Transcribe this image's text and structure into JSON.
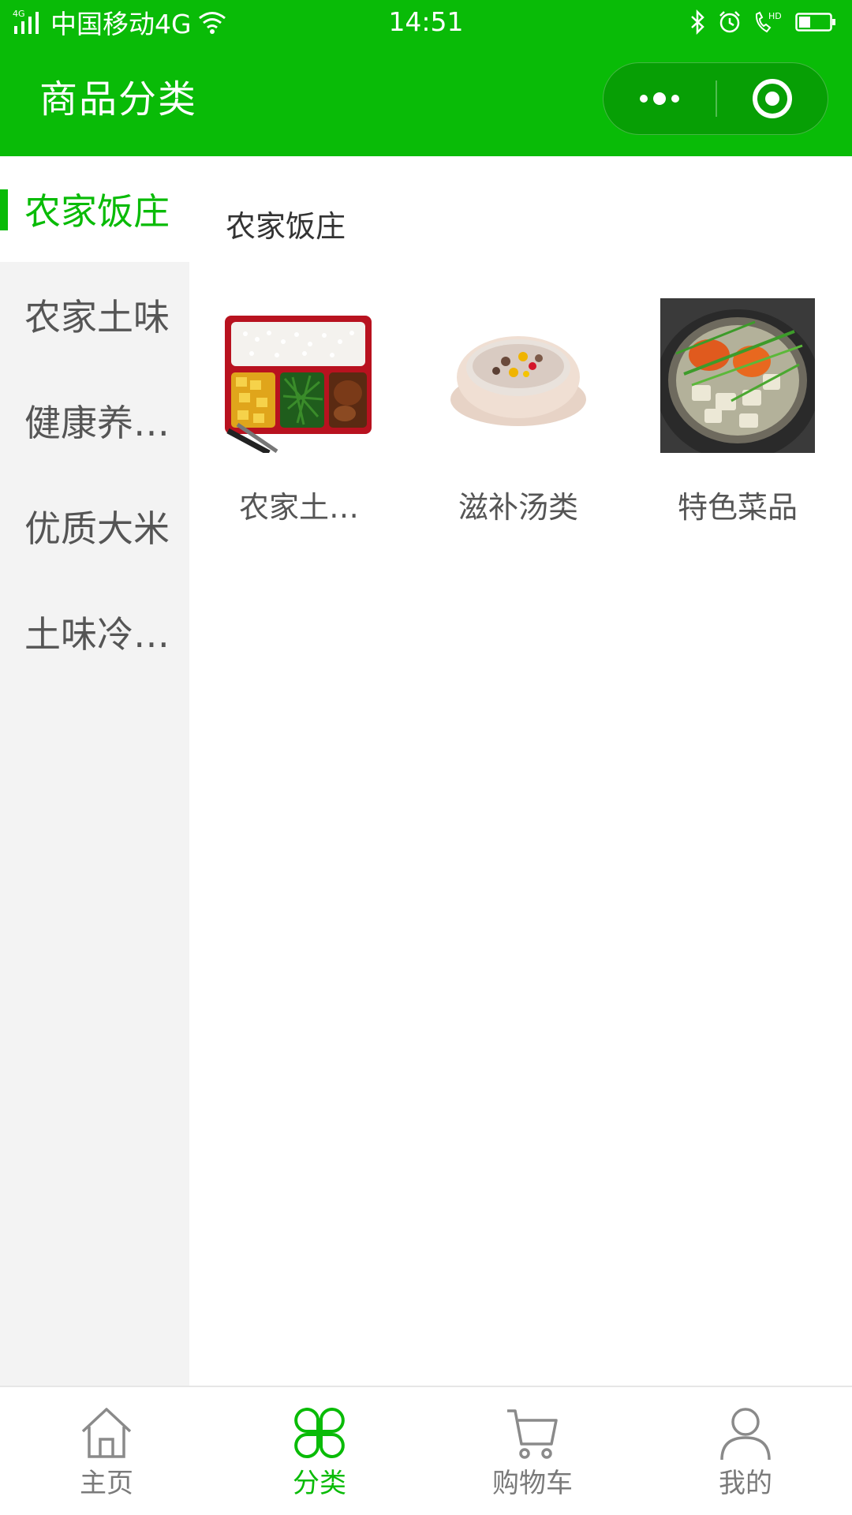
{
  "status_bar": {
    "network_type": "4G",
    "carrier": "中国移动4G",
    "time": "14:51",
    "hd_label": "HD"
  },
  "nav_bar": {
    "title": "商品分类",
    "bg_color": "#09bb07"
  },
  "sidebar": {
    "items": [
      {
        "label": "农家饭庄",
        "active": true
      },
      {
        "label": "农家土味",
        "active": false
      },
      {
        "label": "健康养…",
        "active": false
      },
      {
        "label": "优质大米",
        "active": false
      },
      {
        "label": "土味冷…",
        "active": false
      }
    ]
  },
  "content": {
    "section_title": "农家饭庄",
    "products": [
      {
        "label": "农家土…",
        "image": "bento-box-image"
      },
      {
        "label": "滋补汤类",
        "image": "soup-bowl-image"
      },
      {
        "label": "特色菜品",
        "image": "claypot-dish-image"
      }
    ]
  },
  "tab_bar": {
    "tabs": [
      {
        "label": "主页",
        "icon": "home-icon",
        "active": false
      },
      {
        "label": "分类",
        "icon": "category-icon",
        "active": true
      },
      {
        "label": "购物车",
        "icon": "cart-icon",
        "active": false
      },
      {
        "label": "我的",
        "icon": "profile-icon",
        "active": false
      }
    ]
  },
  "colors": {
    "accent": "#09bb07",
    "sidebar_bg": "#f3f3f3",
    "text_gray": "#555555"
  }
}
